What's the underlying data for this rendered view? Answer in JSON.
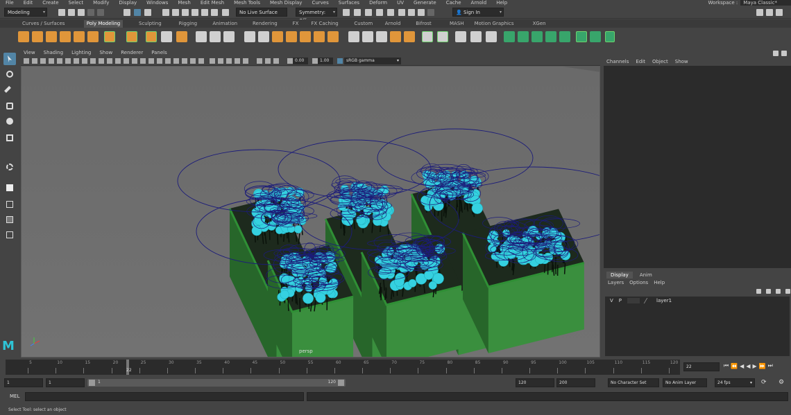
{
  "menubar": {
    "items": [
      "File",
      "Edit",
      "Create",
      "Select",
      "Modify",
      "Display",
      "Windows",
      "Mesh",
      "Edit Mesh",
      "Mesh Tools",
      "Mesh Display",
      "Curves",
      "Surfaces",
      "Deform",
      "UV",
      "Generate",
      "Cache",
      "Arnold",
      "Help"
    ],
    "workspace_label": "Workspace :",
    "workspace_value": "Maya Classic*"
  },
  "statusline": {
    "menuset": "Modeling",
    "live_surface": "No Live Surface",
    "symmetry": "Symmetry: Off",
    "sign_in": "Sign In"
  },
  "shelf_tabs": [
    "Curves / Surfaces",
    "Poly Modeling",
    "Sculpting",
    "Rigging",
    "Animation",
    "Rendering",
    "FX",
    "FX Caching",
    "Custom",
    "Arnold",
    "Bifrost",
    "MASH",
    "Motion Graphics",
    "XGen"
  ],
  "shelf_active_tab": "Poly Modeling",
  "panel_menu": [
    "View",
    "Shading",
    "Lighting",
    "Show",
    "Renderer",
    "Panels"
  ],
  "panel_toolbar": {
    "exposure": "0.00",
    "gamma": "1.00",
    "colorspace": "sRGB gamma"
  },
  "viewport": {
    "camera_label": "persp",
    "colors": {
      "bg": "#6e6e6e",
      "planter": "#3a8f3e",
      "planter_dark": "#27662a",
      "flower": "#35d1e0",
      "curve": "#1c1c7a"
    }
  },
  "channel_box": {
    "menus": [
      "Channels",
      "Edit",
      "Object",
      "Show"
    ]
  },
  "layer_editor": {
    "tabs": [
      "Display",
      "Anim"
    ],
    "menus": [
      "Layers",
      "Options",
      "Help"
    ],
    "layers": [
      {
        "v": "V",
        "p": "P",
        "name": "layer1"
      }
    ]
  },
  "time_slider": {
    "ticks": [
      5,
      10,
      15,
      20,
      25,
      30,
      35,
      40,
      45,
      50,
      55,
      60,
      65,
      70,
      75,
      80,
      85,
      90,
      95,
      100,
      105,
      110,
      115,
      120
    ],
    "current_frame": "22",
    "current_frame_field": "22"
  },
  "range_slider": {
    "start": "1",
    "inner_start": "1",
    "range_start_label": "1",
    "range_end_label": "120",
    "end": "120",
    "anim_end": "200",
    "character_set": "No Character Set",
    "anim_layer": "No Anim Layer",
    "fps": "24 fps"
  },
  "command_line": {
    "language": "MEL"
  },
  "help_line": {
    "text": "Select Tool: select an object"
  }
}
